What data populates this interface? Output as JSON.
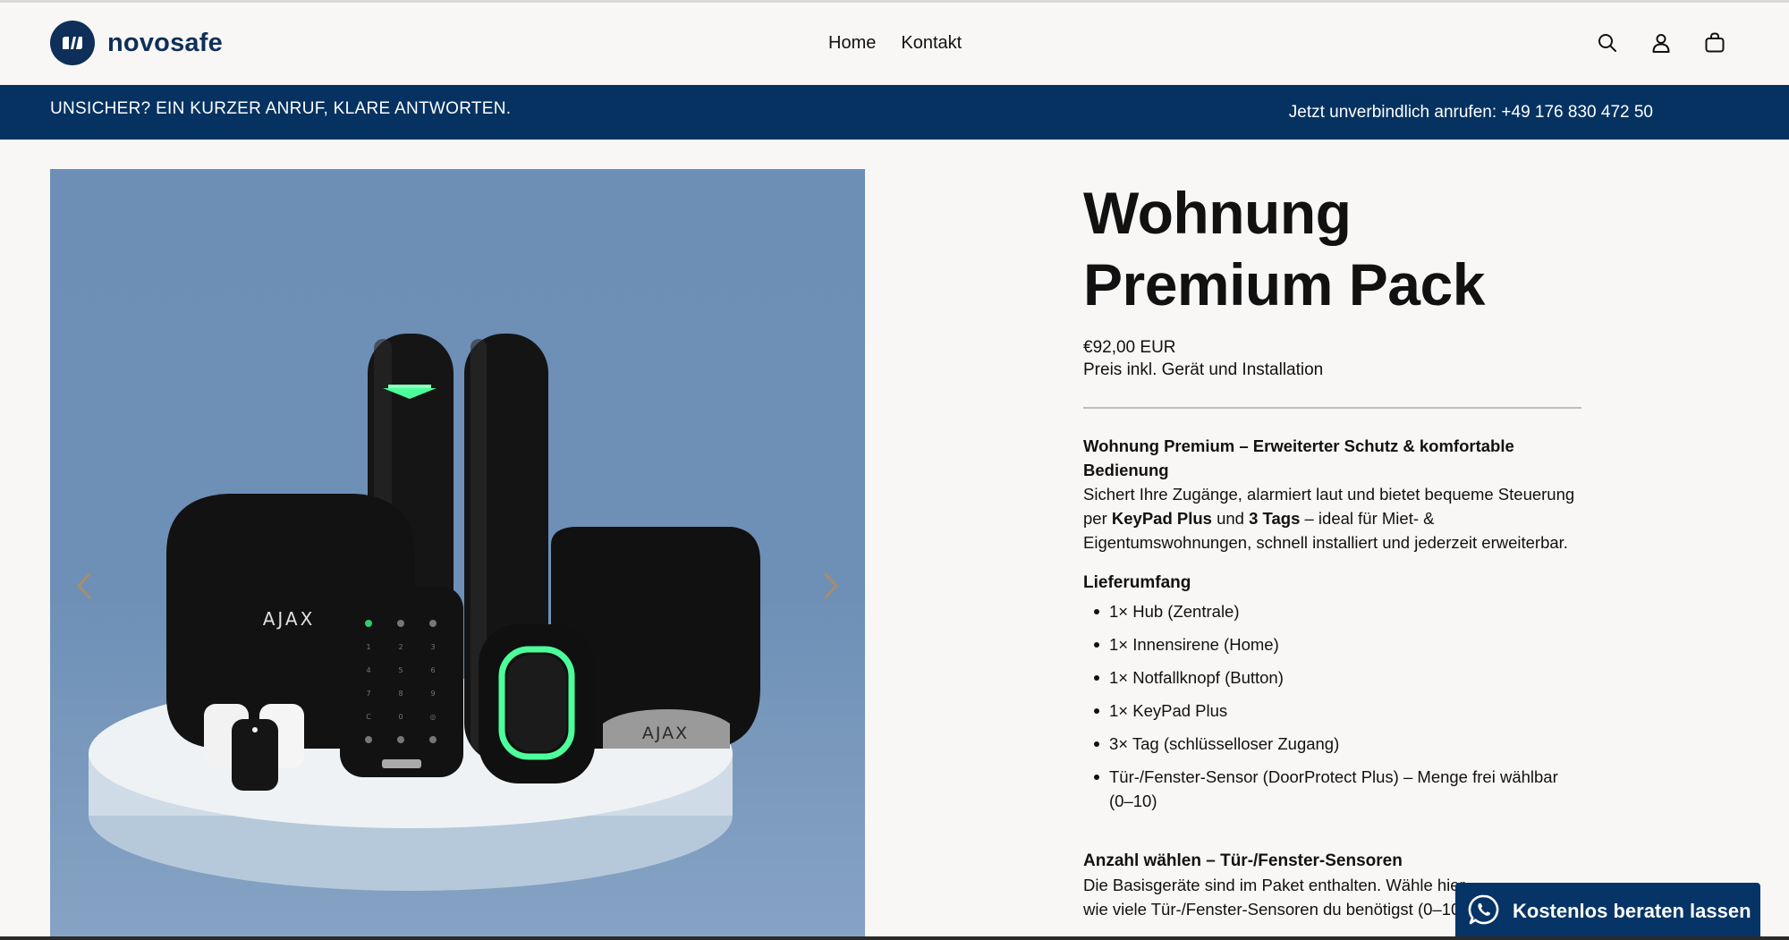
{
  "header": {
    "brand": "novosafe",
    "nav": [
      {
        "label": "Home"
      },
      {
        "label": "Kontakt"
      }
    ],
    "icons": [
      "search-icon",
      "account-icon",
      "cart-icon"
    ]
  },
  "announcement": {
    "left": "UNSICHER? EIN KURZER ANRUF, KLARE ANTWORTEN.",
    "right": "Jetzt unverbindlich anrufen: +49 176 830 472 50"
  },
  "gallery": {
    "brand_print": "AJAX"
  },
  "product": {
    "title_line1": "Wohnung",
    "title_line2": "Premium Pack",
    "price": "€92,00 EUR",
    "price_note": "Preis inkl. Gerät und Installation",
    "desc_head": "Wohnung Premium – Erweiterter Schutz & komfortable Bedienung",
    "desc_part1": "Sichert Ihre Zugänge, alarmiert laut und bietet bequeme Steuerung per ",
    "desc_bold1": "KeyPad Plus",
    "desc_part2": " und ",
    "desc_bold2": "3 Tags",
    "desc_part3": " – ideal für Miet- & Eigentumswohnungen, schnell installiert und jederzeit erweiterbar.",
    "scope_head": "Lieferumfang",
    "scope_items": [
      "1× Hub (Zentrale)",
      "1× Innensirene (Home)",
      "1× Notfallknopf (Button)",
      "1× KeyPad Plus",
      "3× Tag (schlüsselloser Zugang)",
      "Tür-/Fenster-Sensor (DoorProtect Plus) – Menge frei wählbar (0–10)"
    ],
    "choose_head": "Anzahl wählen – Tür-/Fenster-Sensoren",
    "choose_text": "Die Basisgeräte sind im Paket enthalten. Wähle hier, wie viele Tür-/Fenster-Sensoren du benötigst (0–10)."
  },
  "whatsapp": {
    "label": "Kostenlos beraten lassen",
    "icon": "whatsapp-icon"
  },
  "colors": {
    "brand_navy": "#053261",
    "background": "#f8f7f5",
    "accent_green": "#4dff9a"
  }
}
